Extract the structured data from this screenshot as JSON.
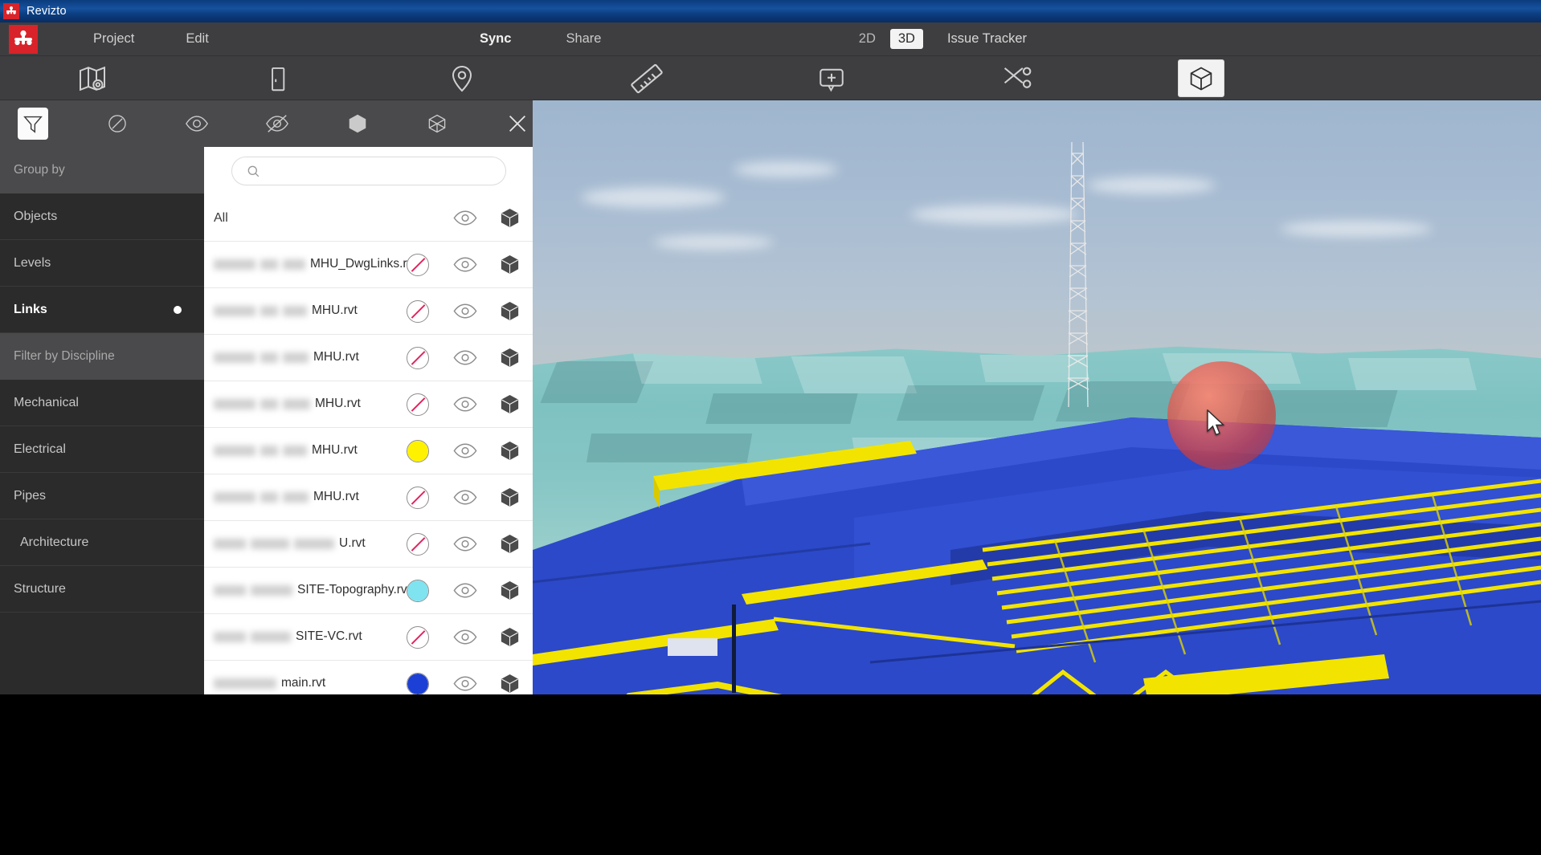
{
  "window": {
    "title": "Revizto",
    "logo_icon": "revizto-logo-icon"
  },
  "menubar": {
    "left_items": [
      {
        "label": "Project",
        "name": "menu-project"
      },
      {
        "label": "Edit",
        "name": "menu-edit"
      }
    ],
    "center_items": [
      {
        "label": "Sync",
        "name": "menu-sync",
        "emphasis": true
      },
      {
        "label": "Share",
        "name": "menu-share",
        "emphasis": false
      }
    ],
    "view_modes": [
      {
        "label": "2D",
        "active": false
      },
      {
        "label": "3D",
        "active": true
      }
    ],
    "issue_tracker_label": "Issue Tracker"
  },
  "toolbar": {
    "items": [
      {
        "name": "sheets-map-icon",
        "active": false
      },
      {
        "name": "door-panel-icon",
        "active": false
      },
      {
        "name": "location-pin-icon",
        "active": false
      },
      {
        "name": "measure-ruler-icon",
        "active": false
      },
      {
        "name": "add-markup-icon",
        "active": false
      },
      {
        "name": "section-cut-icon",
        "active": false
      },
      {
        "name": "cube-3d-icon",
        "active": true
      }
    ]
  },
  "panel": {
    "tabs": [
      {
        "name": "filter-funnel-icon",
        "active": true
      },
      {
        "name": "circle-slash-icon",
        "active": false
      },
      {
        "name": "eye-icon",
        "active": false
      },
      {
        "name": "eye-slash-icon",
        "active": false
      },
      {
        "name": "cube-solid-icon",
        "active": false
      },
      {
        "name": "cube-wireframe-icon",
        "active": false
      },
      {
        "name": "close-icon",
        "active": false
      }
    ]
  },
  "sidebar": {
    "group_by_header": "Group by",
    "group_by_items": [
      {
        "label": "Objects",
        "active": false,
        "has_dot": false
      },
      {
        "label": "Levels",
        "active": false,
        "has_dot": false
      },
      {
        "label": "Links",
        "active": true,
        "has_dot": true
      }
    ],
    "discipline_header": "Filter by Discipline",
    "discipline_items": [
      {
        "label": "Mechanical",
        "indent": false
      },
      {
        "label": "Electrical",
        "indent": false
      },
      {
        "label": "Pipes",
        "indent": false
      },
      {
        "label": "Architecture",
        "indent": true
      },
      {
        "label": "Structure",
        "indent": false
      }
    ]
  },
  "search": {
    "placeholder": "",
    "value": "",
    "icon": "search-icon"
  },
  "list": {
    "all_row": {
      "label": "All",
      "eye_icon": "eye-icon",
      "cube_icon": "cube-solid-icon"
    },
    "rows": [
      {
        "redacted_prefix_widths": [
          52,
          22,
          28
        ],
        "name": "MHU_DwgLinks.rvt",
        "color": "none",
        "eye_icon": "eye-icon",
        "cube_icon": "cube-solid-icon"
      },
      {
        "redacted_prefix_widths": [
          52,
          22,
          30
        ],
        "name": "MHU.rvt",
        "color": "none",
        "eye_icon": "eye-icon",
        "cube_icon": "cube-solid-icon"
      },
      {
        "redacted_prefix_widths": [
          52,
          22,
          32
        ],
        "name": "MHU.rvt",
        "color": "none",
        "eye_icon": "eye-icon",
        "cube_icon": "cube-solid-icon"
      },
      {
        "redacted_prefix_widths": [
          52,
          22,
          34
        ],
        "name": "MHU.rvt",
        "color": "none",
        "eye_icon": "eye-icon",
        "cube_icon": "cube-solid-icon"
      },
      {
        "redacted_prefix_widths": [
          52,
          22,
          30
        ],
        "name": "MHU.rvt",
        "color": "#FFF200",
        "eye_icon": "eye-icon",
        "cube_icon": "cube-solid-icon"
      },
      {
        "redacted_prefix_widths": [
          52,
          22,
          32
        ],
        "name": "MHU.rvt",
        "color": "none",
        "eye_icon": "eye-icon",
        "cube_icon": "cube-solid-icon"
      },
      {
        "redacted_prefix_widths": [
          40,
          48,
          50
        ],
        "name": "U.rvt",
        "color": "none",
        "eye_icon": "eye-icon",
        "cube_icon": "cube-solid-icon"
      },
      {
        "redacted_prefix_widths": [
          40,
          52
        ],
        "name": "SITE-Topography.rvt",
        "color": "#7FE3F0",
        "eye_icon": "eye-icon",
        "cube_icon": "cube-solid-icon"
      },
      {
        "redacted_prefix_widths": [
          40,
          50
        ],
        "name": "SITE-VC.rvt",
        "color": "none",
        "eye_icon": "eye-icon",
        "cube_icon": "cube-solid-icon"
      },
      {
        "redacted_prefix_widths": [
          78
        ],
        "name": "main.rvt",
        "color": "#1C3FD6",
        "eye_icon": "eye-icon",
        "cube_icon": "cube-solid-icon"
      }
    ]
  },
  "viewport": {
    "name": "3d-model-viewport",
    "cursor_icon": "mouse-cursor-icon",
    "colors": {
      "terrain": "#85C6C5",
      "building": "#2B47C8",
      "rebar": "#F2E400",
      "sphere": "#D84B3C",
      "sky_top": "#9FB6CF",
      "sky_bottom": "#A08D66"
    }
  }
}
